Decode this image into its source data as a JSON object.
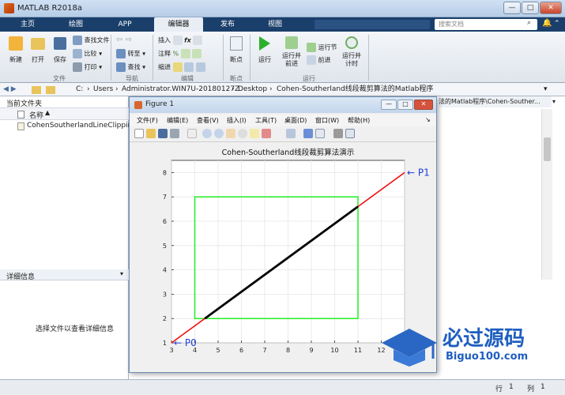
{
  "window": {
    "title": "MATLAB R2018a",
    "minimize": "—",
    "maximize": "□",
    "close": "✕"
  },
  "tabs": [
    "主页",
    "绘图",
    "APP",
    "编辑器",
    "发布",
    "视图"
  ],
  "active_tab": 3,
  "search": {
    "placeholder": "搜索文档"
  },
  "ribbon": {
    "file": {
      "new": "新建",
      "open": "打开",
      "save": "保存",
      "find_files": "查找文件",
      "compare": "比较",
      "print": "打印",
      "group": "文件"
    },
    "navigate": {
      "goto": "转至",
      "find": "查找",
      "group": "导航"
    },
    "edit": {
      "insert": "插入",
      "comment": "注释",
      "indent": "缩进",
      "group": "编辑"
    },
    "breakpoints": {
      "label": "断点",
      "group": "断点"
    },
    "run": {
      "run": "运行",
      "run_advance": "运行并\n前进",
      "run_section": "运行节",
      "advance": "前进",
      "run_time": "运行并\n计时",
      "group": "运行"
    }
  },
  "path": [
    "C:",
    "Users",
    "Administrator.WIN7U-20180127Z",
    "Desktop",
    "Cohen-Southerland线段裁剪算法的Matlab程序"
  ],
  "editor_path_tail": "法的Matlab程序\\Cohen-Souther...",
  "current_folder": {
    "title": "当前文件夹",
    "column": "名称",
    "files": [
      "CohenSoutherlandLineClipping.m"
    ]
  },
  "details": {
    "title": "详细信息",
    "message": "选择文件以查看详细信息"
  },
  "status": {
    "row_label": "行",
    "row": "1",
    "col_label": "列",
    "col": "1"
  },
  "figure": {
    "title": "Figure 1",
    "menu": [
      "文件(F)",
      "编辑(E)",
      "查看(V)",
      "插入(I)",
      "工具(T)",
      "桌面(D)",
      "窗口(W)",
      "帮助(H)"
    ]
  },
  "chart_data": {
    "type": "line",
    "title": "Cohen-Southerland线段裁剪算法演示",
    "xlabel": "",
    "ylabel": "",
    "xlim": [
      3,
      13
    ],
    "ylim": [
      1,
      8.5
    ],
    "xticks": [
      3,
      4,
      5,
      6,
      7,
      8,
      9,
      10,
      11,
      12,
      13
    ],
    "yticks": [
      1,
      2,
      3,
      4,
      5,
      6,
      7,
      8
    ],
    "grid": true,
    "rectangle": {
      "xmin": 4,
      "xmax": 11,
      "ymin": 2,
      "ymax": 7,
      "color": "#22ee22"
    },
    "original_line": {
      "x": [
        3,
        13
      ],
      "y": [
        1,
        8
      ],
      "color": "#ee1111"
    },
    "clipped_line": {
      "x": [
        4.43,
        11
      ],
      "y": [
        2,
        6.6
      ],
      "color": "#000000"
    },
    "annotations": [
      {
        "text": "← P0",
        "x": 3,
        "y": 1
      },
      {
        "text": "← P1",
        "x": 13,
        "y": 8
      }
    ]
  },
  "watermark": {
    "brand": "必过源码",
    "domain": "Biguo100.com"
  }
}
